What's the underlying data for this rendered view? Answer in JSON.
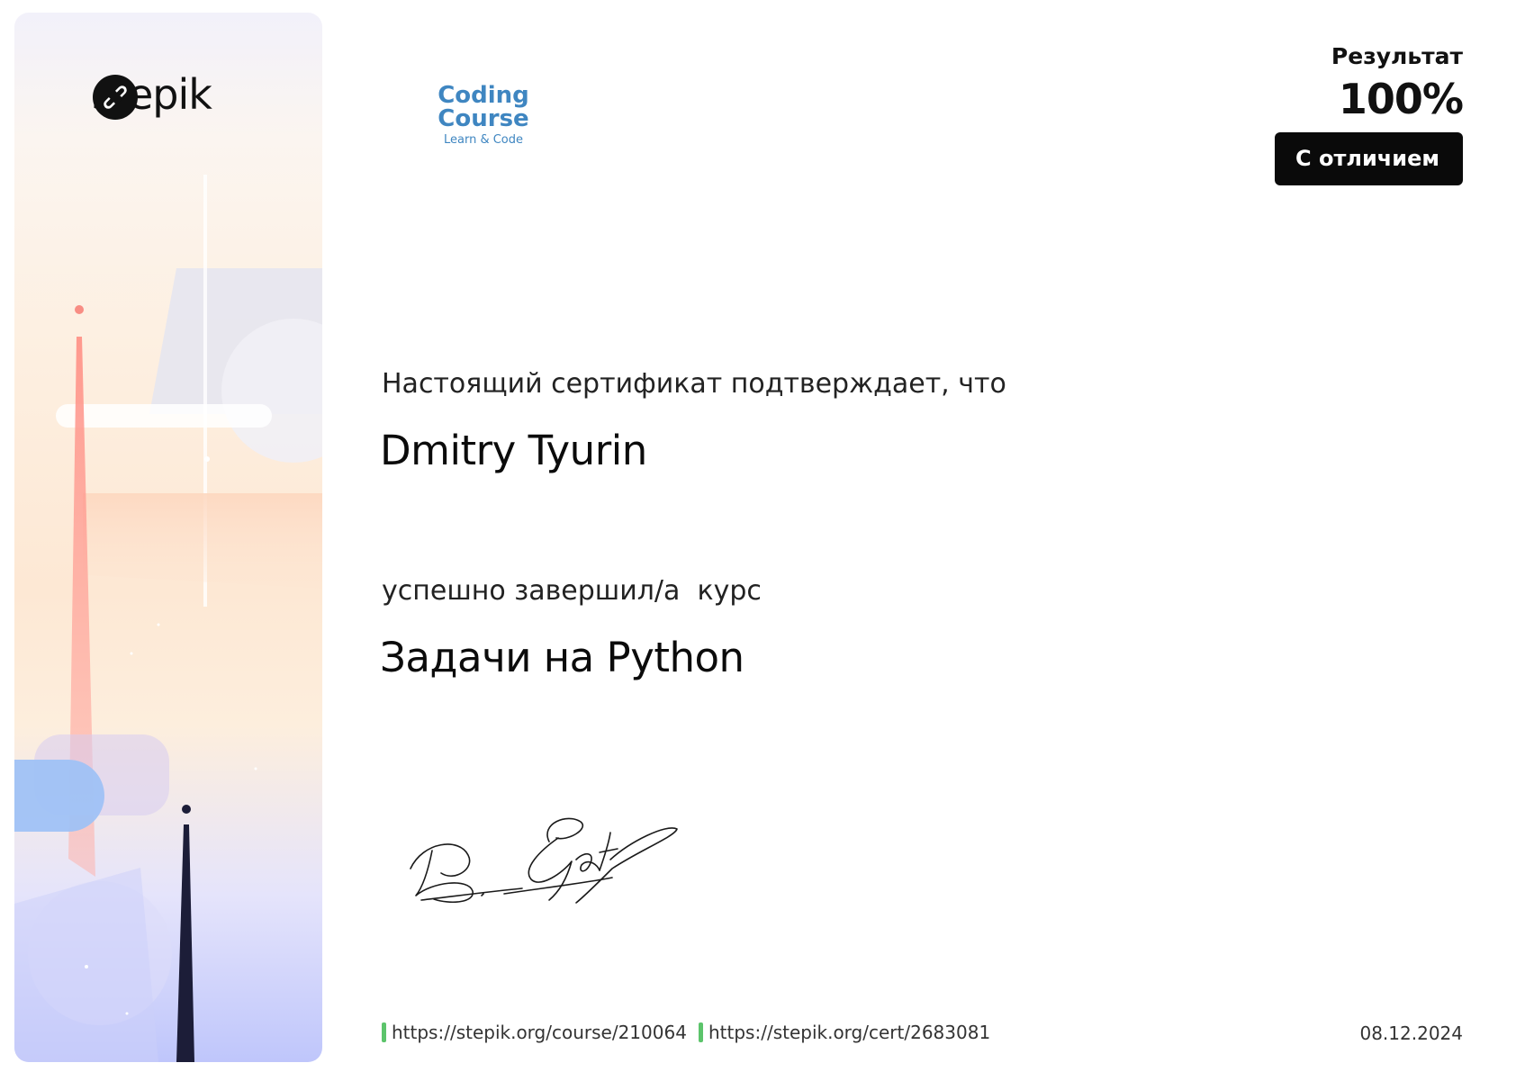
{
  "brand": {
    "wordmark": "stepik",
    "logo_icon": "stepik-link-icon"
  },
  "partner": {
    "name": "Coding Course",
    "tagline": "Learn & Code",
    "color": "#3f86c1"
  },
  "result": {
    "label": "Результат",
    "value": "100%",
    "badge": "С отличием"
  },
  "certificate": {
    "statement": "Настоящий сертификат подтверждает, что",
    "recipient": "Dmitry Tyurin",
    "completed_text": "успешно завершил/а  курс",
    "course_title": "Задачи на Python"
  },
  "signature": {
    "type": "handwritten"
  },
  "footer": {
    "course_url": "https://stepik.org/course/210064",
    "cert_url": "https://stepik.org/cert/2683081",
    "date": "08.12.2024",
    "marker_color": "#5cc46b"
  }
}
